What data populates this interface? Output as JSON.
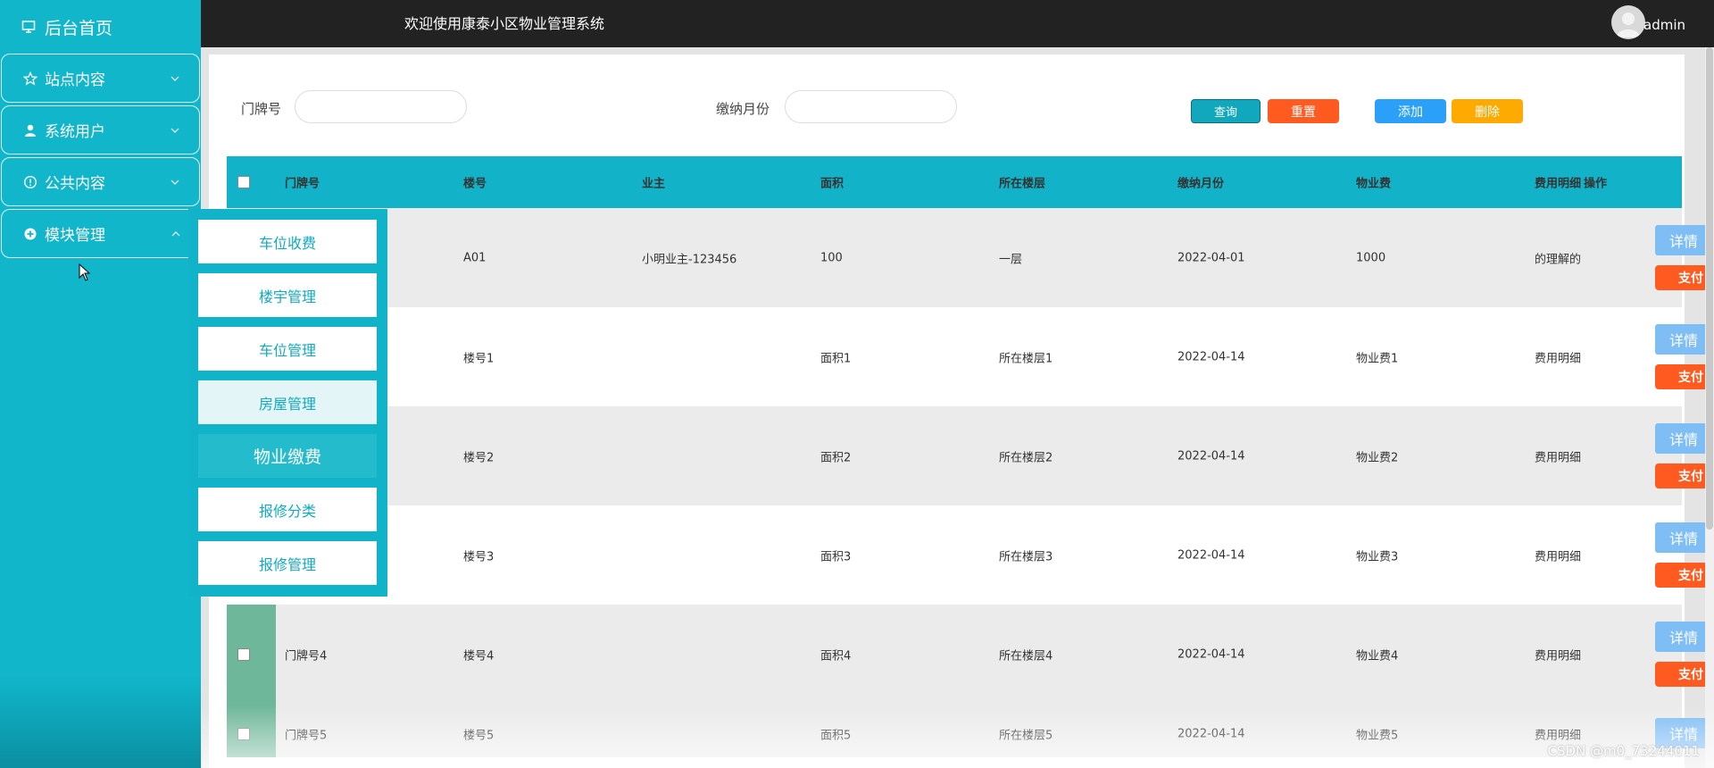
{
  "sidebar": {
    "home": "后台首页",
    "items": [
      {
        "label": "站点内容"
      },
      {
        "label": "系统用户"
      },
      {
        "label": "公共内容"
      },
      {
        "label": "模块管理"
      }
    ]
  },
  "header": {
    "welcome": "欢迎使用康泰小区物业管理系统",
    "username": "admin"
  },
  "search": {
    "door_label": "门牌号",
    "month_label": "缴纳月份",
    "query_btn": "查询",
    "reset_btn": "重置",
    "add_btn": "添加",
    "delete_btn": "删除"
  },
  "colors": {
    "sidebar": "#11b6cb",
    "query": "#11a8be",
    "reset": "#ff5a1f",
    "add": "#2aa0f8",
    "delete": "#ffaa00"
  },
  "table": {
    "headers": [
      "门牌号",
      "楼号",
      "业主",
      "面积",
      "所在楼层",
      "缴纳月份",
      "物业费",
      "费用明细",
      "操作"
    ],
    "detail_btn": "详情",
    "pay_btn": "支付",
    "rows": [
      {
        "door": "",
        "building": "A01",
        "owner": "小明业主-123456",
        "area": "100",
        "floor": "一层",
        "month": "2022-04-01",
        "fee": "1000",
        "detail": "的理解的"
      },
      {
        "door": "",
        "building": "楼号1",
        "owner": "",
        "area": "面积1",
        "floor": "所在楼层1",
        "month": "2022-04-14",
        "fee": "物业费1",
        "detail": "费用明细"
      },
      {
        "door": "",
        "building": "楼号2",
        "owner": "",
        "area": "面积2",
        "floor": "所在楼层2",
        "month": "2022-04-14",
        "fee": "物业费2",
        "detail": "费用明细"
      },
      {
        "door": "",
        "building": "楼号3",
        "owner": "",
        "area": "面积3",
        "floor": "所在楼层3",
        "month": "2022-04-14",
        "fee": "物业费3",
        "detail": "费用明细"
      },
      {
        "door": "门牌号4",
        "building": "楼号4",
        "owner": "",
        "area": "面积4",
        "floor": "所在楼层4",
        "month": "2022-04-14",
        "fee": "物业费4",
        "detail": "费用明细"
      },
      {
        "door": "门牌号5",
        "building": "楼号5",
        "owner": "",
        "area": "面积5",
        "floor": "所在楼层5",
        "month": "2022-04-14",
        "fee": "物业费5",
        "detail": "费用明细"
      }
    ]
  },
  "dropdown": {
    "items": [
      "车位收费",
      "楼宇管理",
      "车位管理",
      "房屋管理",
      "物业缴费",
      "报修分类",
      "报修管理"
    ],
    "hovered": "房屋管理",
    "active": "物业缴费"
  },
  "watermark": "CSDN @m0_73244011"
}
